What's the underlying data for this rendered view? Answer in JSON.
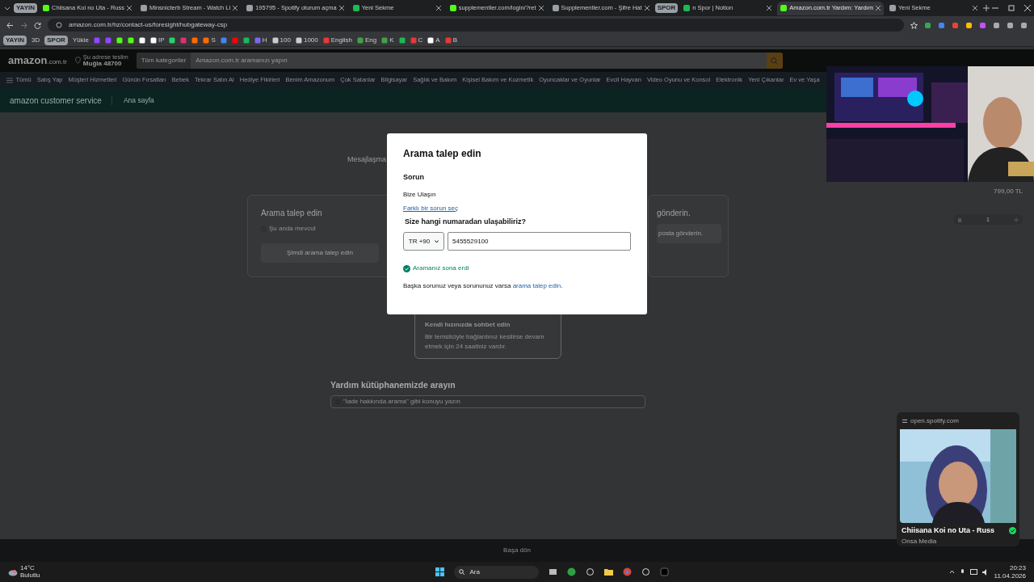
{
  "browser": {
    "tabs": [
      {
        "kind": "group",
        "label": "YAYIN"
      },
      {
        "kind": "tab",
        "label": "Chiisana Koi no Uta - Russ",
        "selected": false
      },
      {
        "kind": "tab",
        "label": "Minsnicterb Stream - Watch Li",
        "selected": false
      },
      {
        "kind": "tab",
        "label": "195795 - Spotify oturum açma",
        "selected": false
      },
      {
        "kind": "tab",
        "label": "Yeni Sekme",
        "selected": false
      },
      {
        "kind": "tab",
        "label": "supplementler.com/login/?ret",
        "selected": false
      },
      {
        "kind": "tab",
        "label": "Supplementler.com - Şifre Hat",
        "selected": false
      },
      {
        "kind": "group",
        "label": "SPOR"
      },
      {
        "kind": "tab",
        "label": "n Spor | Notion",
        "selected": false
      },
      {
        "kind": "tab",
        "label": "Amazon.com.tr Yardım: Yardım",
        "selected": true
      },
      {
        "kind": "tab",
        "label": "Yeni Sekme",
        "selected": false
      }
    ],
    "address": "amazon.com.tr/hz/contact-us/foresight/hubgateway-csp",
    "bookmarks": [
      {
        "kind": "group",
        "label": "YAYIN"
      },
      {
        "kind": "text",
        "label": "3D"
      },
      {
        "kind": "group",
        "label": "SPOR"
      },
      {
        "kind": "text",
        "label": "Yükle"
      },
      {
        "kind": "icon",
        "color": "#9146ff"
      },
      {
        "kind": "icon",
        "color": "#9146ff"
      },
      {
        "kind": "icon",
        "color": "#53fc18"
      },
      {
        "kind": "icon",
        "color": "#53fc18"
      },
      {
        "kind": "icon",
        "color": "#ffffff"
      },
      {
        "kind": "icon",
        "label": "IP",
        "color": "#ffffff"
      },
      {
        "kind": "icon",
        "color": "#25d366"
      },
      {
        "kind": "icon",
        "color": "#e1306c"
      },
      {
        "kind": "icon",
        "color": "#ff6a00"
      },
      {
        "kind": "icon",
        "label": "S",
        "color": "#ff6a00"
      },
      {
        "kind": "icon",
        "color": "#4285f4"
      },
      {
        "kind": "icon",
        "color": "#ff0000"
      },
      {
        "kind": "icon",
        "color": "#1db954"
      },
      {
        "kind": "icon",
        "label": "H",
        "color": "#7b68ee"
      },
      {
        "kind": "icon",
        "label": "100",
        "color": "#cccccc"
      },
      {
        "kind": "icon",
        "label": "1000",
        "color": "#cccccc"
      },
      {
        "kind": "icon",
        "label": "English",
        "color": "#e53935"
      },
      {
        "kind": "icon",
        "label": "Eng",
        "color": "#43a047"
      },
      {
        "kind": "icon",
        "label": "K",
        "color": "#43a047"
      },
      {
        "kind": "icon",
        "color": "#1db954"
      },
      {
        "kind": "icon",
        "label": "C",
        "color": "#e53935"
      },
      {
        "kind": "icon",
        "label": "A",
        "color": "#ffffff"
      },
      {
        "kind": "icon",
        "label": "B",
        "color": "#e53935"
      }
    ]
  },
  "amazon": {
    "logo": "amazon",
    "logo_suffix": ".com.tr",
    "deliver_line": "Şu adrese teslim",
    "deliver_place": "Muğla 48700",
    "search_category": "Tüm kategoriler",
    "search_placeholder": "Amazon.com.tr aramanızı yapın",
    "nav": [
      "Tümü",
      "Satış Yap",
      "Müşteri Hizmetleri",
      "Günün Fırsatları",
      "Bebek",
      "Tekrar Satın Al",
      "Hediye Fikirleri",
      "Benim Amazonum",
      "Çok Satanlar",
      "Bilgisayar",
      "Sağlık ve Bakım",
      "Kişisel Bakım ve Kozmetik",
      "Oyuncaklar ve Oyunlar",
      "Evcil Hayvan",
      "Video Oyunu ve Konsol",
      "Elektronik",
      "Yeni Çıkanlar",
      "Ev ve Yaşa"
    ],
    "cs_logo": "amazon customer service",
    "cs_home": "Ana sayfa"
  },
  "page": {
    "heading": "Mesajlaşma",
    "call_card": {
      "title": "Arama talep edin",
      "availability": "Şu anda mevcut",
      "button": "Şimdi arama talep edin"
    },
    "mail_card": {
      "title": "gönderin.",
      "button": "posta gönderin."
    },
    "chat_card": {
      "title": "Kendi hızınızda sohbet edin",
      "text": "Bir temsilciyle bağlantınız kesilirse devam etmek için 24 saatiniz vardır."
    },
    "library_title": "Yardım kütüphanemizde arayın",
    "library_placeholder": "\"İade hakkında arama\" gibi konuyu yazın",
    "cart_price": "799,00 TL",
    "cart_qty": "1",
    "footer": "Başa dön"
  },
  "modal": {
    "title": "Arama talep edin",
    "issue_label": "Sorun",
    "issue": "Bize Ulaşın",
    "change_link": "Farklı bir sorun seç",
    "question": "Size hangi numaradan ulaşabiliriz?",
    "country": "TR +90",
    "phone": "5455529100",
    "status": "Aramanız sona erdi",
    "footer_text": "Başka sorunuz veya sorununuz varsa ",
    "footer_link": "arama talep edin",
    "footer_end": "."
  },
  "media_popup": {
    "source": "open.spotify.com",
    "title": "Chiisana Koi no Uta - Russ",
    "artist": "Onsa Media",
    "saved": true
  },
  "taskbar": {
    "temperature": "14°C",
    "weather": "Bulutlu",
    "search": "Ara",
    "time": "20:23",
    "date": "11.04.2026"
  }
}
